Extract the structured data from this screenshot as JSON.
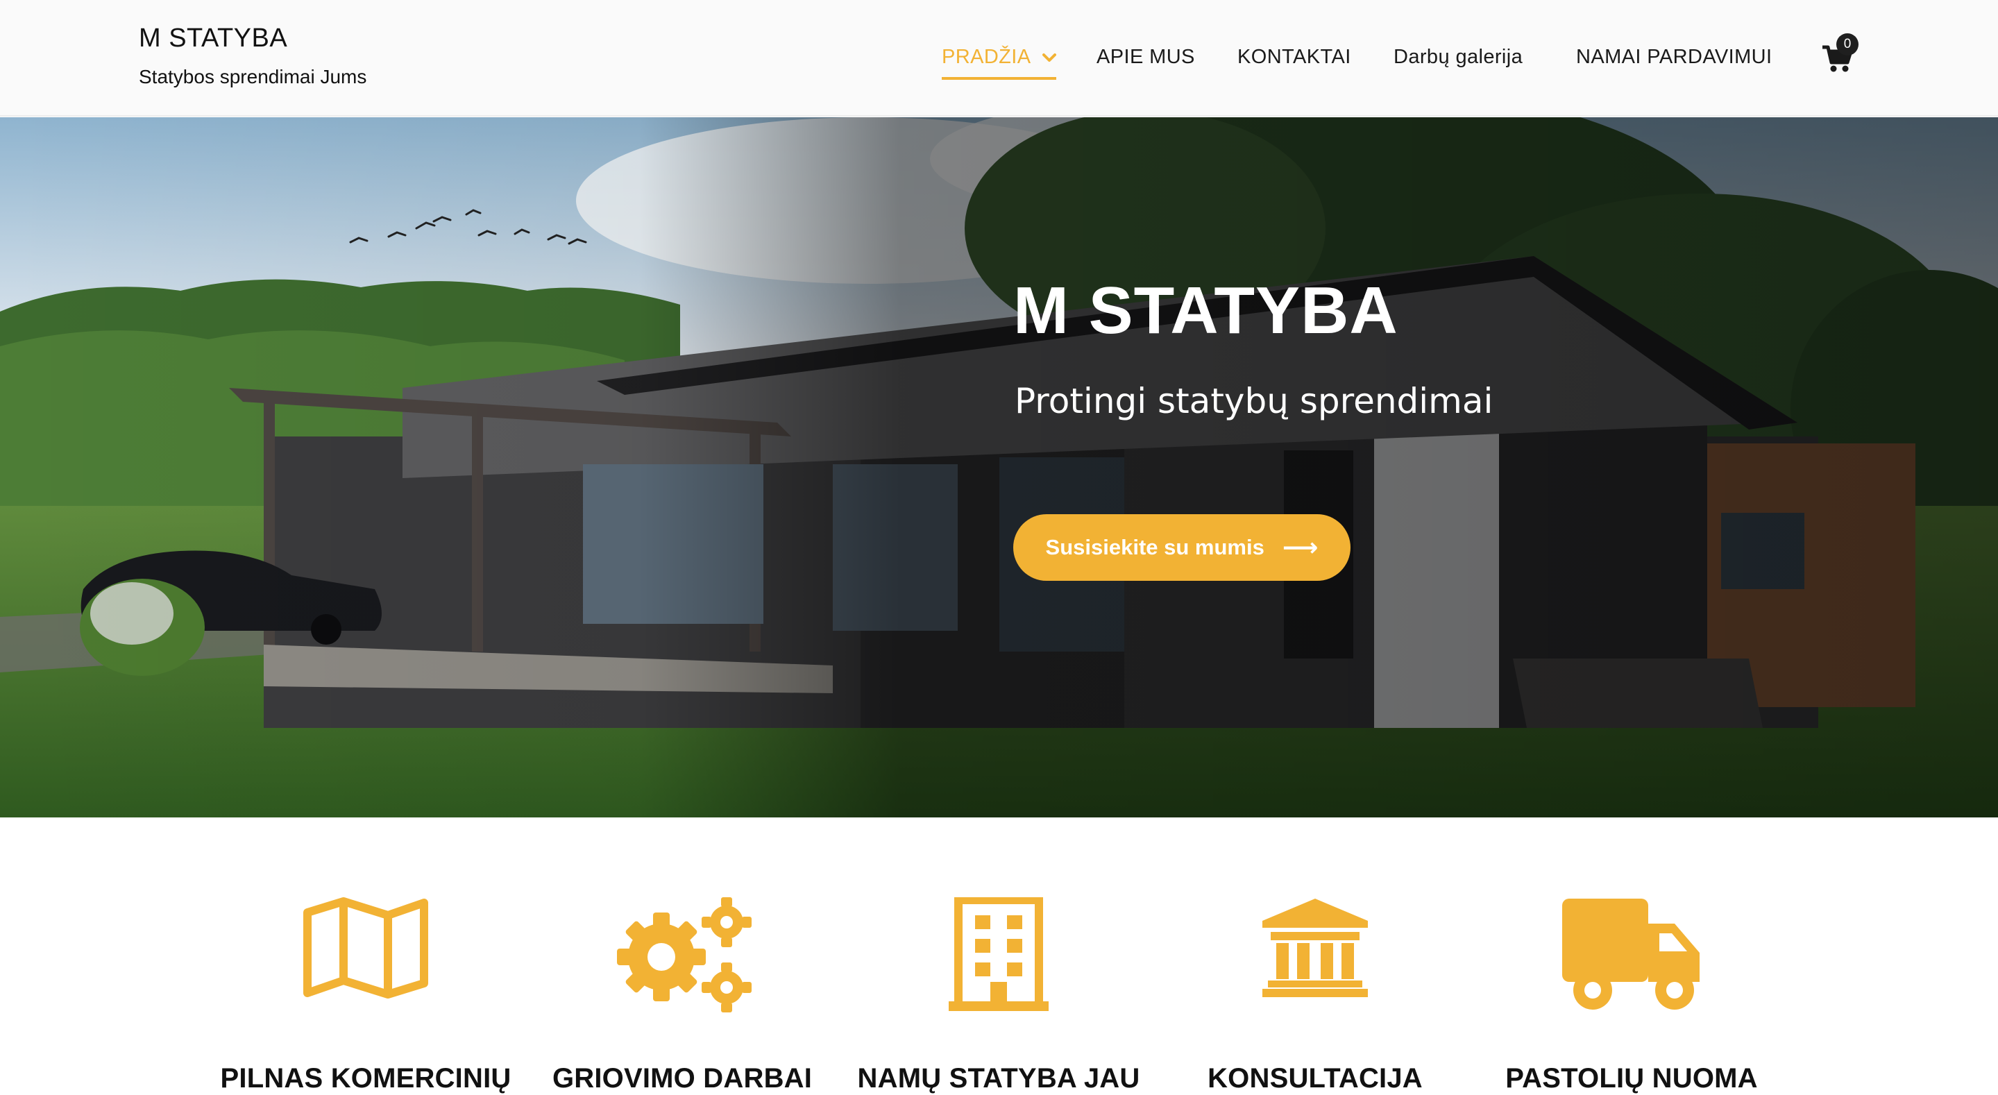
{
  "brand": {
    "title": "M STATYBA",
    "tagline": "Statybos sprendimai Jums"
  },
  "nav": {
    "items": [
      {
        "label": "PRADŽIA",
        "active": true,
        "has_dropdown": true
      },
      {
        "label": "APIE MUS"
      },
      {
        "label": "KONTAKTAI"
      },
      {
        "label": "Darbų galerija"
      },
      {
        "label": "NAMAI PARDAVIMUI"
      }
    ],
    "cart_icon": "shopping-cart-icon",
    "cart_count": "0"
  },
  "hero": {
    "title": "M STATYBA",
    "subtitle": "Protingi statybų sprendimai",
    "cta_label": "Susisiekite su mumis",
    "cta_icon": "arrow-right-icon"
  },
  "services": [
    {
      "icon": "map-icon",
      "label": "PILNAS KOMERCINIŲ"
    },
    {
      "icon": "gears-icon",
      "label": "GRIOVIMO DARBAI"
    },
    {
      "icon": "building-icon",
      "label": "NAMŲ STATYBA JAU"
    },
    {
      "icon": "bank-icon",
      "label": "KONSULTACIJA"
    },
    {
      "icon": "truck-icon",
      "label": "PASTOLIŲ NUOMA"
    }
  ],
  "colors": {
    "accent": "#f2b234",
    "text": "#111111",
    "header_bg": "#fafafa",
    "badge_bg": "#1f1f1f"
  }
}
